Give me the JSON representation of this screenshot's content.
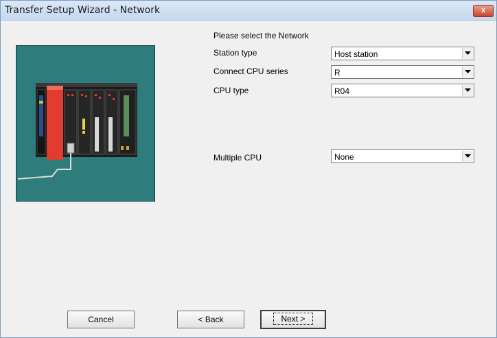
{
  "window": {
    "title": "Transfer Setup Wizard - Network",
    "close_glyph": "x"
  },
  "form": {
    "heading": "Please select the Network",
    "station_type": {
      "label": "Station type",
      "value": "Host station"
    },
    "cpu_series": {
      "label": "Connect CPU series",
      "value": "R"
    },
    "cpu_type": {
      "label": "CPU type",
      "value": "R04"
    },
    "multiple_cpu": {
      "label": "Multiple CPU",
      "value": "None"
    }
  },
  "buttons": {
    "cancel": "Cancel",
    "back": "< Back",
    "next": "Next >"
  },
  "icons": {
    "dropdown": "chevron-down-icon",
    "close": "close-icon",
    "illustration": "plc-unit-illustration"
  },
  "colors": {
    "illustration_bg": "#2e7c7c",
    "cpu_module": "#e23b2f"
  }
}
